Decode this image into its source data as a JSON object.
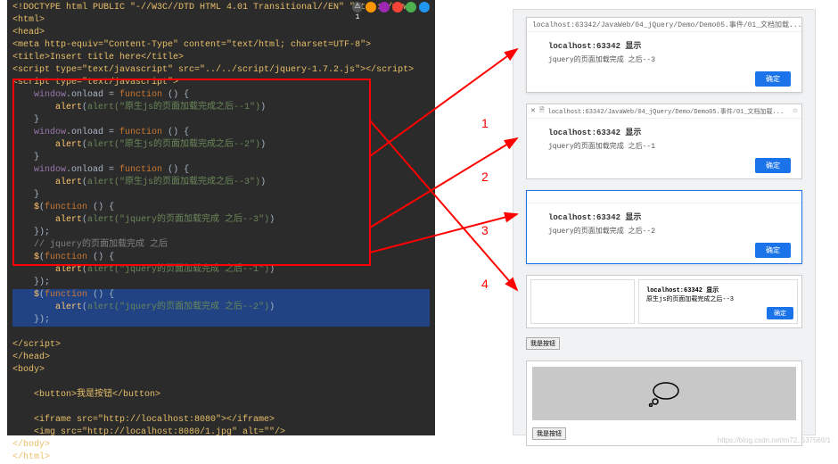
{
  "code": {
    "doctype": "<!DOCTYPE html PUBLIC \"-//W3C//DTD HTML 4.01 Transitional//EN\" \"http://www.",
    "html_open": "<html>",
    "head_open": "<head>",
    "meta": "<meta http-equiv=\"Content-Type\" content=\"text/html; charset=UTF-8\">",
    "title": "<title>Insert title here</title>",
    "script1": "<script type=\"text/javascript\" src=\"../../script/jquery-1.7.2.js\"></script>",
    "script2_open": "<script type=\"text/javascript\">",
    "onload1_a": "window.onload = function () {",
    "onload1_b": "alert(\"原生js的页面加载完成之后--1\")",
    "close_brace": "}",
    "onload2_a": "window.onload = function () {",
    "onload2_b": "alert(\"原生js的页面加载完成之后--2\")",
    "onload3_a": "window.onload = function () {",
    "onload3_b": "alert(\"原生js的页面加载完成之后--3\")",
    "jq1_a": "$(function () {",
    "jq1_b": "alert(\"jquery的页面加载完成 之后--3\")",
    "jq_close": "});",
    "jq_comment": "// jquery的页面加载完成 之后",
    "jq2_a": "$(function () {",
    "jq2_b": "alert(\"jquery的页面加载完成 之后--1\")",
    "jq3_a": "$(function () {",
    "jq3_b": "alert(\"jquery的页面加载完成 之后--2\")",
    "script_close": "</script>",
    "head_close": "</head>",
    "body_open": "<body>",
    "button": "<button>我是按钮</button>",
    "iframe": "<iframe src=\"http://localhost:8080\"></iframe>",
    "img": "<img src=\"http://localhost:8080/1.jpg\" alt=\"\"/>",
    "body_close": "</body>",
    "html_close": "</html>"
  },
  "dialogs": {
    "url_long": "localhost:63342/JavaWeb/04_jQuery/Demo/Demo05.事件/01_文档加载...",
    "host": "localhost:63342 显示",
    "msg1": "jquery的页面加载完成 之后--3",
    "msg2": "jquery的页面加载完成 之后--1",
    "msg3": "jquery的页面加载完成 之后--2",
    "msg4": "原生js的页面加载完成之后--3",
    "ok": "确定",
    "btn_label": "我是按钮"
  },
  "labels": {
    "n1": "1",
    "n2": "2",
    "n3": "3",
    "n4": "4"
  },
  "toolbar_warn": "⚠ 1",
  "watermark": "https://blog.csdn.net/m72..637566/1"
}
